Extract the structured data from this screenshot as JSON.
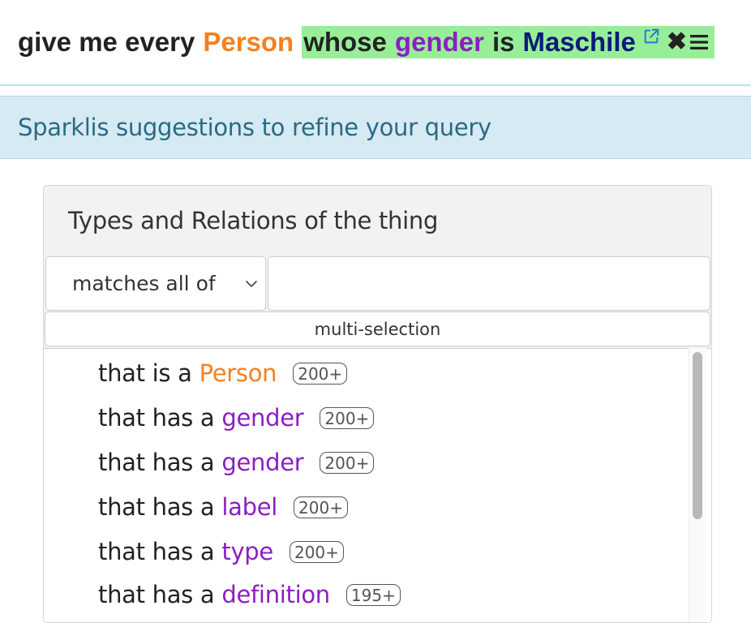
{
  "query": {
    "prefix": "give me every",
    "class_term": "Person",
    "focus_whose": "whose",
    "focus_property": "gender",
    "focus_is": "is",
    "focus_entity": "Maschile",
    "icons": [
      "external-link-icon",
      "close-icon",
      "menu-icon"
    ],
    "colors": {
      "class": "#f5801f",
      "property": "#8b1fc0",
      "entity": "#0a1a78",
      "focus_highlight": "#98ee98"
    }
  },
  "banner": {
    "text": "Sparklis suggestions to refine your query"
  },
  "panel": {
    "title": "Types and Relations of the thing",
    "select_value": "matches all of",
    "filter_value": "",
    "multi_selection_label": "multi-selection",
    "items": [
      {
        "prefix": "that is a",
        "term": "Person",
        "kind": "class",
        "count": "200+"
      },
      {
        "prefix": "that has a",
        "term": "gender",
        "kind": "property",
        "count": "200+"
      },
      {
        "prefix": "that has a",
        "term": "gender",
        "kind": "property",
        "count": "200+"
      },
      {
        "prefix": "that has a",
        "term": "label",
        "kind": "property",
        "count": "200+"
      },
      {
        "prefix": "that has a",
        "term": "type",
        "kind": "property",
        "count": "200+"
      },
      {
        "prefix": "that has a",
        "term": "definition",
        "kind": "property",
        "count": "195+"
      }
    ]
  }
}
